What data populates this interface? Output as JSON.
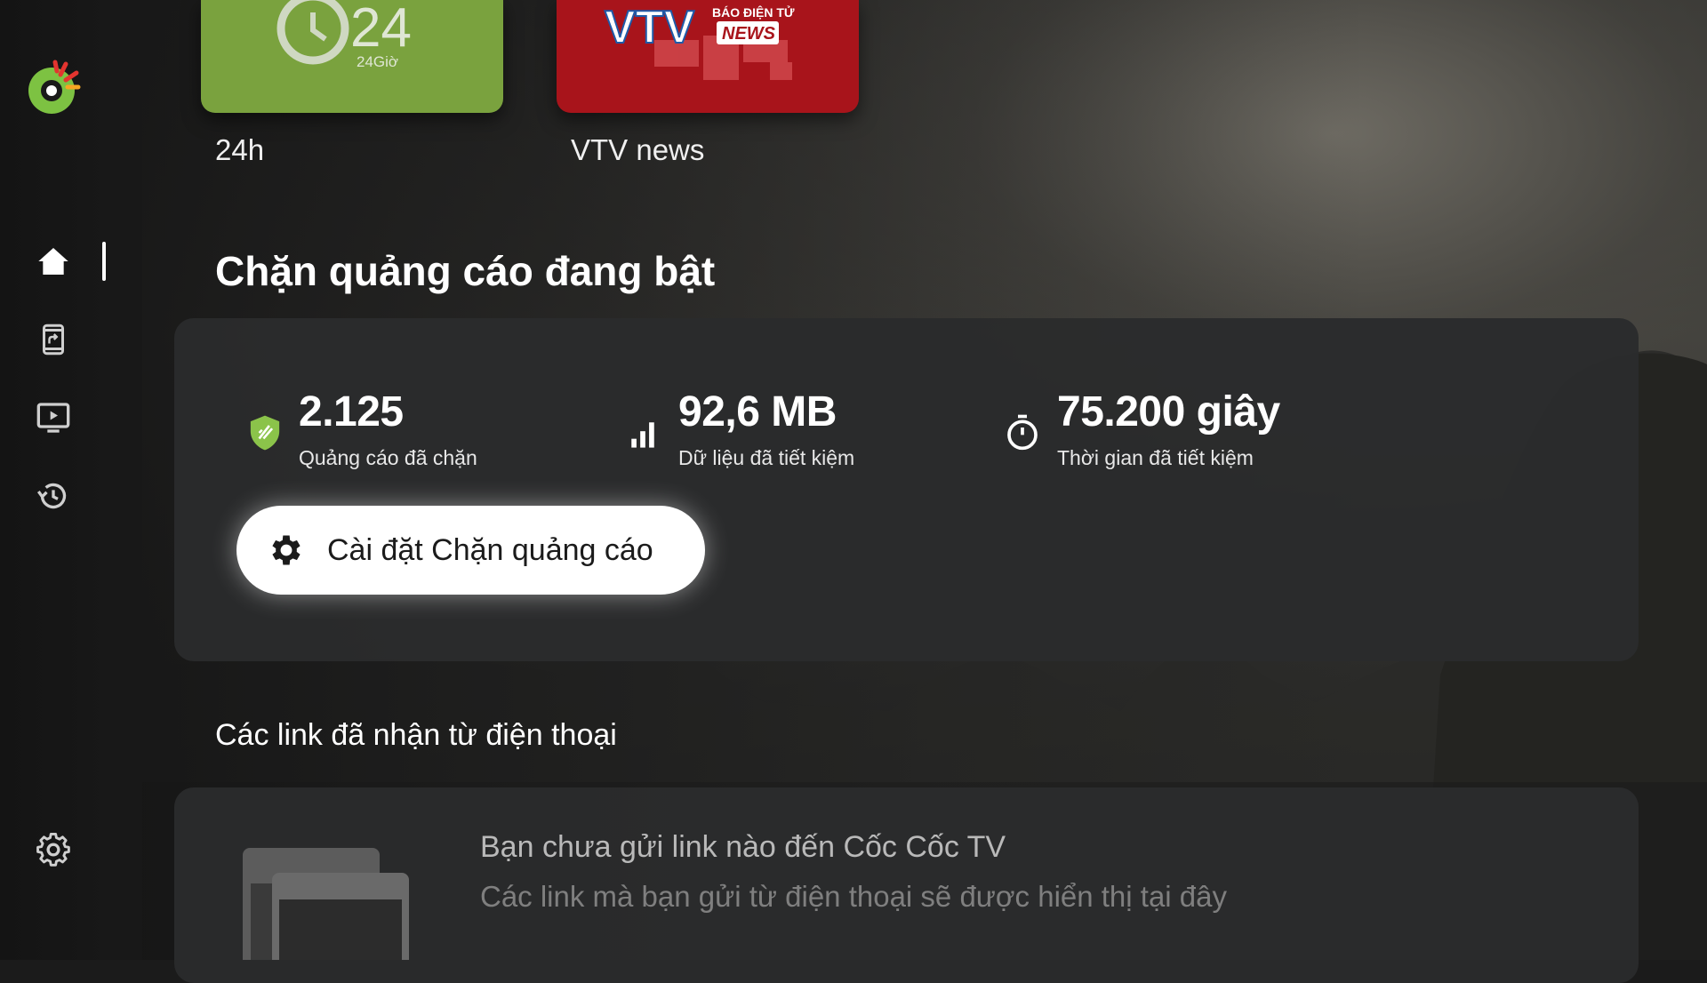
{
  "colors": {
    "brand_green": "#7dc242",
    "brand_red": "#e3342f",
    "shield_green": "#8bc34a",
    "tile_24h": "#7aa23e",
    "tile_vtv": "#a8141b"
  },
  "shortcuts": [
    {
      "label": "24h",
      "logo_text": "24",
      "logo_sub": "24Giờ"
    },
    {
      "label": "VTV news",
      "logo_text": "VTV",
      "logo_badge": "NEWS",
      "logo_top": "BÁO ĐIỆN TỬ"
    }
  ],
  "sidebar": {
    "items": [
      {
        "icon": "home-icon",
        "active": true
      },
      {
        "icon": "phone-share-icon",
        "active": false
      },
      {
        "icon": "tv-play-icon",
        "active": false
      },
      {
        "icon": "history-icon",
        "active": false
      }
    ],
    "settings_icon": "gear-icon"
  },
  "adblock": {
    "title": "Chặn quảng cáo đang bật",
    "stats": [
      {
        "value": "2.125",
        "label": "Quảng cáo đã chặn",
        "icon": "shield-icon"
      },
      {
        "value": "92,6 MB",
        "label": "Dữ liệu đã tiết kiệm",
        "icon": "signal-bars-icon"
      },
      {
        "value": "75.200 giây",
        "label": "Thời gian đã tiết kiệm",
        "icon": "stopwatch-icon"
      }
    ],
    "settings_button": "Cài đặt Chặn quảng cáo"
  },
  "links": {
    "title": "Các link đã nhận từ điện thoại",
    "empty_title": "Bạn chưa gửi link nào đến Cốc Cốc TV",
    "empty_subtitle": "Các link mà bạn gửi từ điện thoại sẽ được hiển thị tại đây"
  }
}
